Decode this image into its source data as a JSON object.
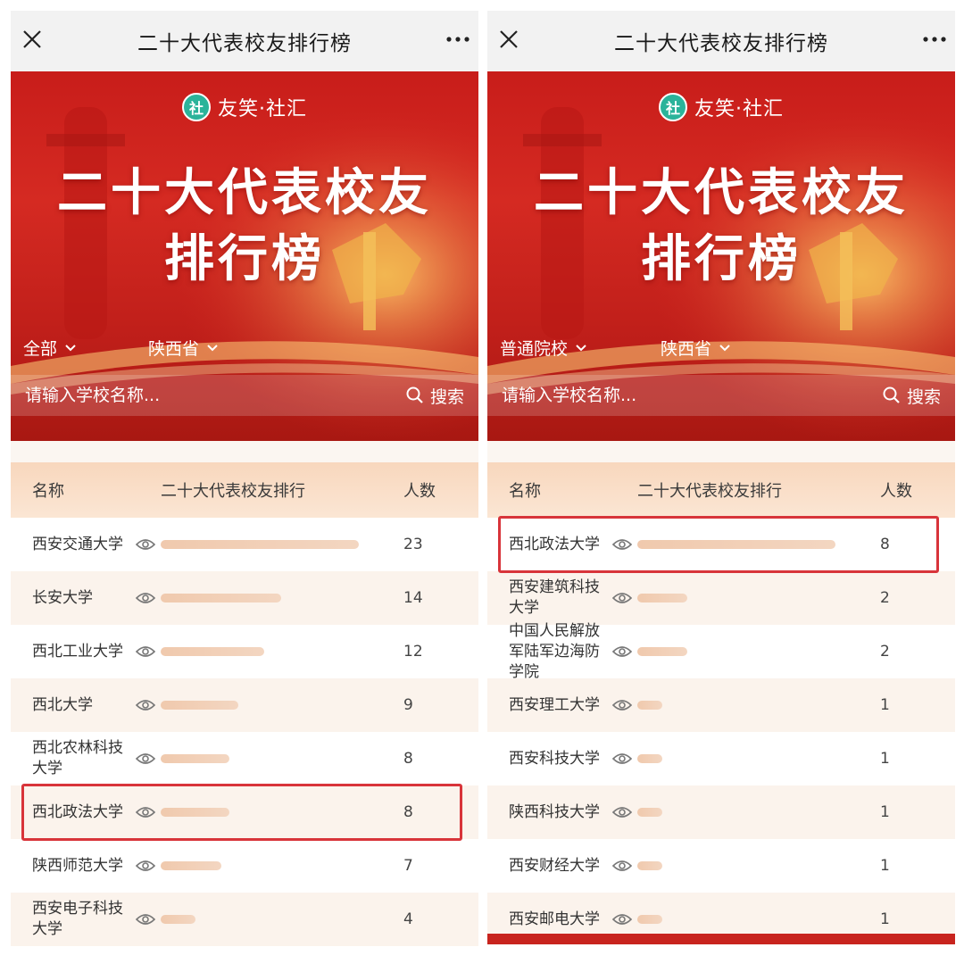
{
  "left": {
    "title": "二十大代表校友排行榜",
    "brand": "友笑·社汇",
    "logo_char": "社",
    "hero_line1": "二十大代表校友",
    "hero_line2": "排行榜",
    "filter_type": "全部",
    "filter_region": "陕西省",
    "search_placeholder": "请输入学校名称...",
    "search_label": "搜索",
    "col_name": "名称",
    "col_rank": "二十大代表校友排行",
    "col_count": "人数",
    "highlight_row": 5,
    "rows": [
      {
        "name": "西安交通大学",
        "count": "23",
        "value": 23
      },
      {
        "name": "长安大学",
        "count": "14",
        "value": 14
      },
      {
        "name": "西北工业大学",
        "count": "12",
        "value": 12
      },
      {
        "name": "西北大学",
        "count": "9",
        "value": 9
      },
      {
        "name": "西北农林科技大学",
        "count": "8",
        "value": 8
      },
      {
        "name": "西北政法大学",
        "count": "8",
        "value": 8
      },
      {
        "name": "陕西师范大学",
        "count": "7",
        "value": 7
      },
      {
        "name": "西安电子科技大学",
        "count": "4",
        "value": 4
      },
      {
        "name": "西安建筑科技",
        "count": "",
        "value": 2
      }
    ]
  },
  "right": {
    "title": "二十大代表校友排行榜",
    "brand": "友笑·社汇",
    "logo_char": "社",
    "hero_line1": "二十大代表校友",
    "hero_line2": "排行榜",
    "filter_type": "普通院校",
    "filter_region": "陕西省",
    "search_placeholder": "请输入学校名称...",
    "search_label": "搜索",
    "col_name": "名称",
    "col_rank": "二十大代表校友排行",
    "col_count": "人数",
    "highlight_row": 0,
    "rows": [
      {
        "name": "西北政法大学",
        "count": "8",
        "value": 8
      },
      {
        "name": "西安建筑科技大学",
        "count": "2",
        "value": 2
      },
      {
        "name": "中国人民解放军陆军边海防学院",
        "count": "2",
        "value": 2
      },
      {
        "name": "西安理工大学",
        "count": "1",
        "value": 1
      },
      {
        "name": "西安科技大学",
        "count": "1",
        "value": 1
      },
      {
        "name": "陕西科技大学",
        "count": "1",
        "value": 1
      },
      {
        "name": "西安财经大学",
        "count": "1",
        "value": 1
      },
      {
        "name": "西安邮电大学",
        "count": "1",
        "value": 1
      }
    ]
  },
  "colors": {
    "primary_red": "#c81d1a",
    "bar": "#f0c9ad",
    "highlight": "#d8343a",
    "logo": "#2bb39a"
  }
}
